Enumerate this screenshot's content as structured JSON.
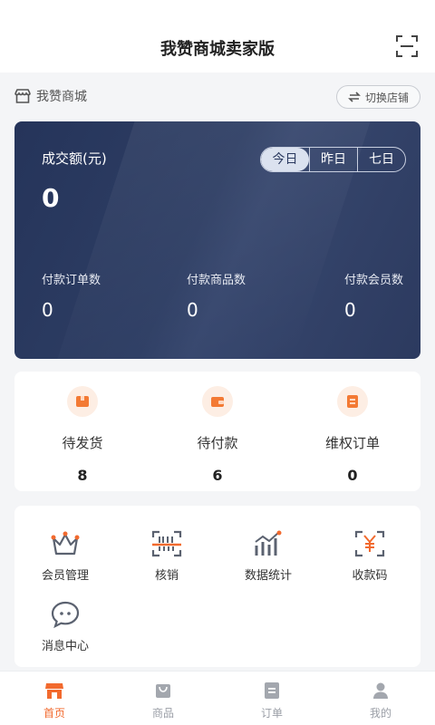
{
  "header": {
    "title": "我赞商城卖家版"
  },
  "store": {
    "name": "我赞商城",
    "switch_label": "切换店铺"
  },
  "sales": {
    "label": "成交额(元)",
    "value": "0",
    "ranges": [
      "今日",
      "昨日",
      "七日"
    ],
    "active_range": "今日",
    "metrics": [
      {
        "label": "付款订单数",
        "value": "0"
      },
      {
        "label": "付款商品数",
        "value": "0"
      },
      {
        "label": "付款会员数",
        "value": "0"
      }
    ]
  },
  "orders": [
    {
      "label": "待发货",
      "count": "8",
      "icon": "box-icon"
    },
    {
      "label": "待付款",
      "count": "6",
      "icon": "wallet-icon"
    },
    {
      "label": "维权订单",
      "count": "0",
      "icon": "rights-icon"
    }
  ],
  "tools": [
    {
      "label": "会员管理",
      "icon": "crown-icon"
    },
    {
      "label": "核销",
      "icon": "barcode-icon"
    },
    {
      "label": "数据统计",
      "icon": "chart-icon"
    },
    {
      "label": "收款码",
      "icon": "yuan-scan-icon"
    },
    {
      "label": "消息中心",
      "icon": "message-icon"
    }
  ],
  "tabbar": [
    {
      "label": "首页",
      "icon": "shop-icon",
      "active": true
    },
    {
      "label": "商品",
      "icon": "bag-icon",
      "active": false
    },
    {
      "label": "订单",
      "icon": "order-icon",
      "active": false
    },
    {
      "label": "我的",
      "icon": "user-icon",
      "active": false
    }
  ],
  "colors": {
    "accent": "#f26a2e",
    "card_dark": "#2b3a60",
    "icon_gray": "#5b6270"
  }
}
